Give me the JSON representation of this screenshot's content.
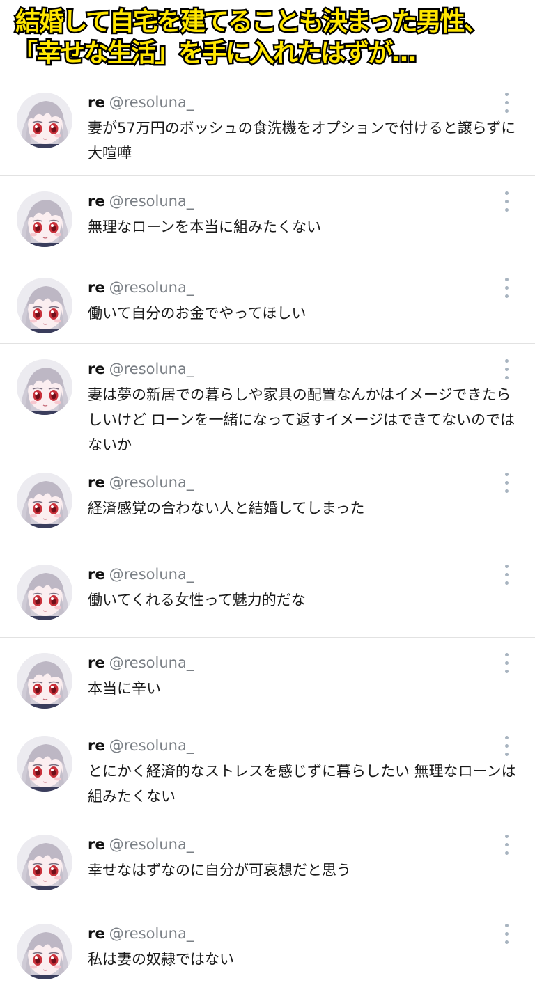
{
  "headline": {
    "line1": "結婚して自宅を建てることも決まった男性、",
    "line2": "「幸せな生活」を手に入れたはずが…"
  },
  "tweets": [
    {
      "name": "re",
      "handle": "@resoluna_",
      "text": "妻が57万円のボッシュの食洗機をオプションで付けると譲らずに大喧嘩",
      "menu_icon": "more-vertical-icon"
    },
    {
      "name": "re",
      "handle": "@resoluna_",
      "text": "無理なローンを本当に組みたくない",
      "menu_icon": "more-vertical-icon"
    },
    {
      "name": "re",
      "handle": "@resoluna_",
      "text": "働いて自分のお金でやってほしい",
      "menu_icon": "more-vertical-icon"
    },
    {
      "name": "re",
      "handle": "@resoluna_",
      "text": "妻は夢の新居での暮らしや家具の配置なんかはイメージできたらしいけど ローンを一緒になって返すイメージはできてないのではないか",
      "menu_icon": "more-vertical-icon"
    },
    {
      "name": "re",
      "handle": "@resoluna_",
      "text": "経済感覚の合わない人と結婚してしまった",
      "menu_icon": "more-vertical-icon"
    },
    {
      "name": "re",
      "handle": "@resoluna_",
      "text": "働いてくれる女性って魅力的だな",
      "menu_icon": "more-vertical-icon"
    },
    {
      "name": "re",
      "handle": "@resoluna_",
      "text": "本当に辛い",
      "menu_icon": "more-vertical-icon"
    },
    {
      "name": "re",
      "handle": "@resoluna_",
      "text": "とにかく経済的なストレスを感じずに暮らしたい 無理なローンは組みたくない",
      "menu_icon": "more-vertical-icon"
    },
    {
      "name": "re",
      "handle": "@resoluna_",
      "text": "幸せなはずなのに自分が可哀想だと思う",
      "menu_icon": "more-vertical-icon"
    },
    {
      "name": "re",
      "handle": "@resoluna_",
      "text": "私は妻の奴隷ではない",
      "menu_icon": "more-vertical-icon"
    }
  ],
  "colors": {
    "headline_fill": "#ffe600",
    "headline_stroke": "#000000",
    "handle": "#7a7f85",
    "divider": "#e2e2e2",
    "menu_dots": "#a8b4c0"
  }
}
